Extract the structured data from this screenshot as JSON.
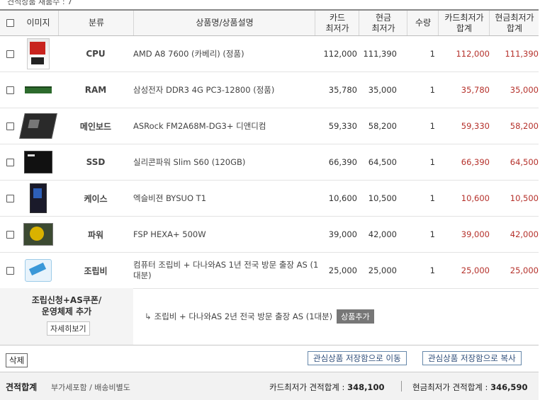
{
  "top_note": "견적상품 재품수 : 7",
  "header": {
    "image": "이미지",
    "category": "분류",
    "name": "상품명/상품설명",
    "card_line1": "카드",
    "card_line2": "최저가",
    "cash_line1": "현금",
    "cash_line2": "최저가",
    "qty": "수량",
    "tcard_line1": "카드최저가",
    "tcard_line2": "합계",
    "tcash_line1": "현금최저가",
    "tcash_line2": "합계"
  },
  "rows": [
    {
      "icon": "cpu-product-image",
      "category": "CPU",
      "name": "AMD A8 7600 (카베리) (정품)",
      "card": "112,000",
      "cash": "111,390",
      "qty": "1",
      "total_card": "112,000",
      "total_cash": "111,390"
    },
    {
      "icon": "ram-product-image",
      "category": "RAM",
      "name": "삼성전자 DDR3 4G PC3-12800 (정품)",
      "card": "35,780",
      "cash": "35,000",
      "qty": "1",
      "total_card": "35,780",
      "total_cash": "35,000"
    },
    {
      "icon": "mainboard-product-image",
      "category": "메인보드",
      "name": "ASRock FM2A68M-DG3+ 디앤디컴",
      "card": "59,330",
      "cash": "58,200",
      "qty": "1",
      "total_card": "59,330",
      "total_cash": "58,200"
    },
    {
      "icon": "ssd-product-image",
      "category": "SSD",
      "name": "실리콘파워 Slim S60 (120GB)",
      "card": "66,390",
      "cash": "64,500",
      "qty": "1",
      "total_card": "66,390",
      "total_cash": "64,500"
    },
    {
      "icon": "case-product-image",
      "category": "케이스",
      "name": "엑슬비젼 BYSUO T1",
      "card": "10,600",
      "cash": "10,500",
      "qty": "1",
      "total_card": "10,600",
      "total_cash": "10,500"
    },
    {
      "icon": "psu-product-image",
      "category": "파워",
      "name": "FSP HEXA+ 500W",
      "card": "39,000",
      "cash": "42,000",
      "qty": "1",
      "total_card": "39,000",
      "total_cash": "42,000"
    },
    {
      "icon": "assembly-product-image",
      "category": "조립비",
      "name": "컴퓨터 조립비 + 다나와AS 1년 전국 방문 출장 AS (1대분)",
      "card": "25,000",
      "cash": "25,000",
      "qty": "1",
      "total_card": "25,000",
      "total_cash": "25,000"
    }
  ],
  "section": {
    "title_line1": "조립신청+AS쿠폰/",
    "title_line2": "운영체제 추가",
    "detail_button": "자세히보기",
    "item_text": "조립비 + 다나와AS 2년 전국 방문 출장 AS (1대분)",
    "add_button": "상품추가"
  },
  "actions": {
    "delete": "삭제",
    "move": "관심상품 저장함으로 이동",
    "copy": "관심상품 저장함으로 복사"
  },
  "footer": {
    "label": "견적합계",
    "sub": "부가세포함 / 배송비별도",
    "card_label": "카드최저가 견적합계 : ",
    "card_total": "348,100",
    "cash_label": "현금최저가 견적합계 : ",
    "cash_total": "346,590"
  }
}
